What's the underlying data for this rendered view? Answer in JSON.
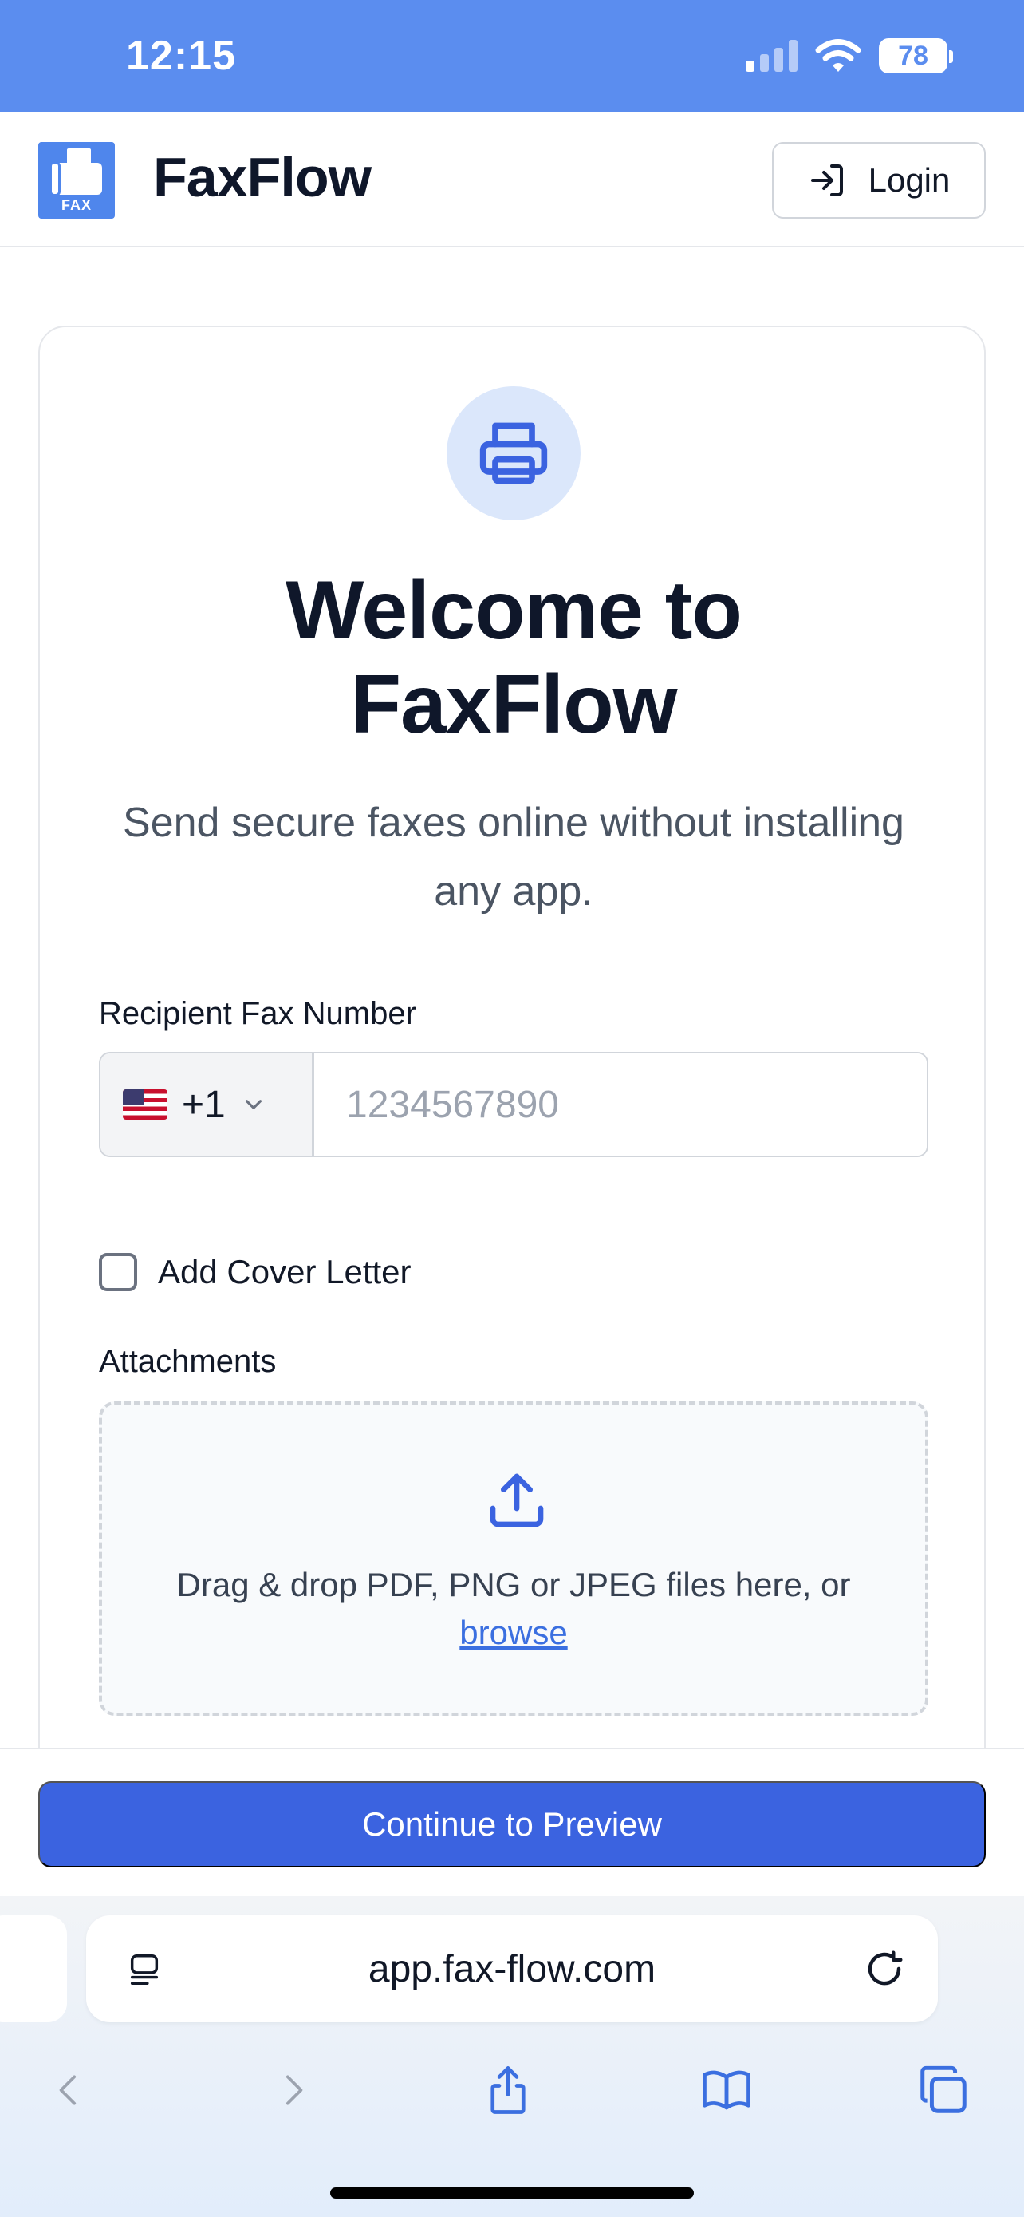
{
  "status": {
    "time": "12:15",
    "battery": "78"
  },
  "header": {
    "brand": "FaxFlow",
    "logo_text": "FAX",
    "login_label": "Login"
  },
  "hero": {
    "title_line1": "Welcome to",
    "title_line2": "FaxFlow",
    "subtitle": "Send secure faxes online without installing any app."
  },
  "form": {
    "fax_label": "Recipient Fax Number",
    "country_code": "+1",
    "fax_placeholder": "1234567890",
    "fax_value": "",
    "cover_letter_label": "Add Cover Letter",
    "cover_letter_checked": false,
    "attachments_label": "Attachments",
    "dropzone_text": "Drag & drop PDF, PNG or JPEG files here, or",
    "browse_label": "browse"
  },
  "action": {
    "continue_label": "Continue to Preview"
  },
  "browser": {
    "url": "app.fax-flow.com"
  },
  "colors": {
    "primary": "#3b63e0",
    "status_bar": "#5b8def",
    "accent_light": "#dbe7fb"
  },
  "icons": [
    "wifi-icon",
    "signal-icon",
    "battery-icon",
    "fax-logo-icon",
    "login-icon",
    "printer-icon",
    "us-flag-icon",
    "chevron-down-icon",
    "upload-icon",
    "reader-icon",
    "reload-icon",
    "back-icon",
    "forward-icon",
    "share-icon",
    "bookmarks-icon",
    "tabs-icon"
  ]
}
